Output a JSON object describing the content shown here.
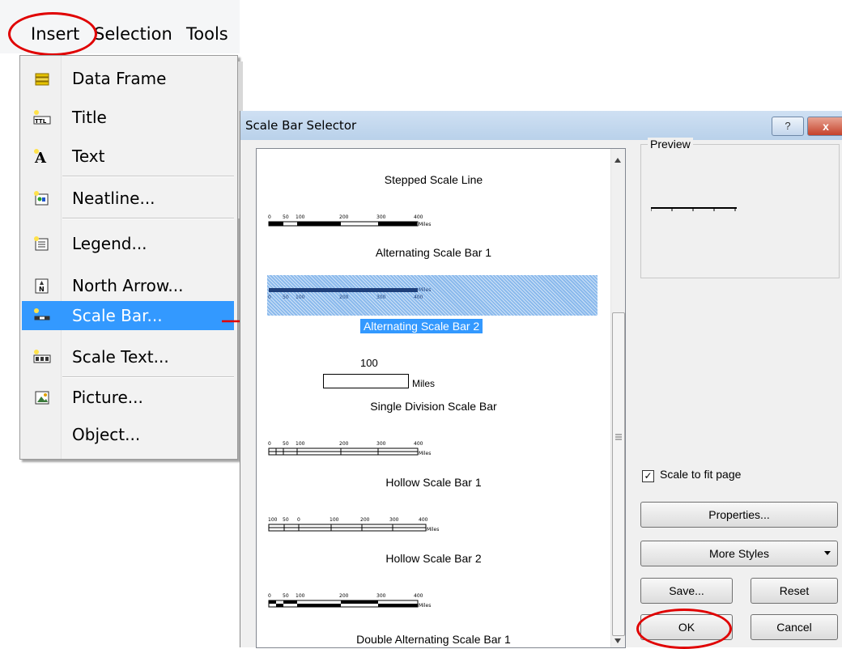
{
  "menubar": {
    "items": [
      "Insert",
      "Selection",
      "Tools"
    ]
  },
  "menu": {
    "items": [
      {
        "label": "Data Frame",
        "icon": "data-frame-icon"
      },
      {
        "label": "Title",
        "icon": "title-icon"
      },
      {
        "label": "Text",
        "icon": "text-icon"
      },
      {
        "label": "Neatline...",
        "icon": "neatline-icon"
      },
      {
        "label": "Legend...",
        "icon": "legend-icon"
      },
      {
        "label": "North Arrow...",
        "icon": "north-arrow-icon"
      },
      {
        "label": "Scale Bar...",
        "icon": "scale-bar-icon"
      },
      {
        "label": "Scale Text...",
        "icon": "scale-text-icon"
      },
      {
        "label": "Picture...",
        "icon": "picture-icon"
      },
      {
        "label": "Object...",
        "icon": ""
      }
    ],
    "highlighted": "Scale Bar..."
  },
  "dialog": {
    "title": "Scale Bar Selector",
    "help": "?",
    "close": "x",
    "styles": [
      "Stepped Scale Line",
      "Alternating Scale Bar 1",
      "Alternating Scale Bar 2",
      "Single Division Scale Bar",
      "Hollow Scale Bar 1",
      "Hollow Scale Bar 2",
      "Double Alternating Scale Bar 1"
    ],
    "selected": "Alternating Scale Bar 2",
    "ticks_a": [
      "0",
      "50",
      "100",
      "200",
      "300",
      "400"
    ],
    "ticks_b": [
      "100",
      "50",
      "0",
      "100",
      "200",
      "300",
      "400"
    ],
    "unit": "Miles",
    "single_division_value": "100",
    "preview_label": "Preview",
    "scale_to_fit_label": "Scale to fit page",
    "scale_to_fit_checked": true,
    "properties_label": "Properties...",
    "more_styles_label": "More Styles",
    "save_label": "Save...",
    "reset_label": "Reset",
    "ok_label": "OK",
    "cancel_label": "Cancel"
  },
  "colors": {
    "highlight": "#3399ff",
    "annotation": "#e00000"
  }
}
